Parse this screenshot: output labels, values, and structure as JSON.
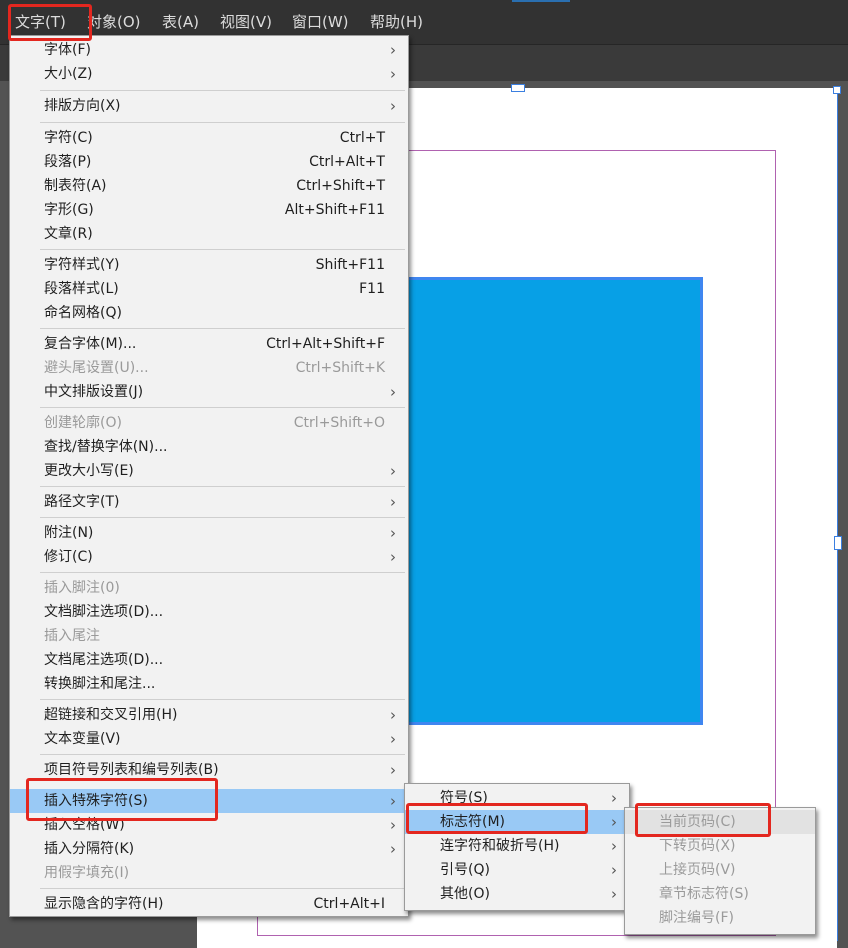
{
  "menubar": {
    "items": [
      {
        "label": "文字(T)"
      },
      {
        "label": "对象(O)"
      },
      {
        "label": "表(A)"
      },
      {
        "label": "视图(V)"
      },
      {
        "label": "窗口(W)"
      },
      {
        "label": "帮助(H)"
      }
    ]
  },
  "type_menu": {
    "items": [
      {
        "label": "字体(F)",
        "shortcut": "",
        "submenu": true
      },
      {
        "label": "大小(Z)",
        "shortcut": "",
        "submenu": true
      },
      {
        "label": "排版方向(X)",
        "shortcut": "",
        "submenu": true
      },
      {
        "label": "字符(C)",
        "shortcut": "Ctrl+T"
      },
      {
        "label": "段落(P)",
        "shortcut": "Ctrl+Alt+T"
      },
      {
        "label": "制表符(A)",
        "shortcut": "Ctrl+Shift+T"
      },
      {
        "label": "字形(G)",
        "shortcut": "Alt+Shift+F11"
      },
      {
        "label": "文章(R)",
        "shortcut": ""
      },
      {
        "label": "字符样式(Y)",
        "shortcut": "Shift+F11"
      },
      {
        "label": "段落样式(L)",
        "shortcut": "F11"
      },
      {
        "label": "命名网格(Q)",
        "shortcut": ""
      },
      {
        "label": "复合字体(M)...",
        "shortcut": "Ctrl+Alt+Shift+F"
      },
      {
        "label": "避头尾设置(U)...",
        "shortcut": "Ctrl+Shift+K",
        "disabled": true
      },
      {
        "label": "中文排版设置(J)",
        "shortcut": "",
        "submenu": true
      },
      {
        "label": "创建轮廓(O)",
        "shortcut": "Ctrl+Shift+O",
        "disabled": true
      },
      {
        "label": "查找/替换字体(N)...",
        "shortcut": ""
      },
      {
        "label": "更改大小写(E)",
        "shortcut": "",
        "submenu": true
      },
      {
        "label": "路径文字(T)",
        "shortcut": "",
        "submenu": true
      },
      {
        "label": "附注(N)",
        "shortcut": "",
        "submenu": true
      },
      {
        "label": "修订(C)",
        "shortcut": "",
        "submenu": true
      },
      {
        "label": "插入脚注(0)",
        "shortcut": "",
        "disabled": true
      },
      {
        "label": "文档脚注选项(D)...",
        "shortcut": ""
      },
      {
        "label": "插入尾注",
        "shortcut": "",
        "disabled": true
      },
      {
        "label": "文档尾注选项(D)...",
        "shortcut": ""
      },
      {
        "label": "转换脚注和尾注...",
        "shortcut": ""
      },
      {
        "label": "超链接和交叉引用(H)",
        "shortcut": "",
        "submenu": true
      },
      {
        "label": "文本变量(V)",
        "shortcut": "",
        "submenu": true
      },
      {
        "label": "项目符号列表和编号列表(B)",
        "shortcut": "",
        "submenu": true
      },
      {
        "label": "插入特殊字符(S)",
        "shortcut": "",
        "submenu": true,
        "highlighted": true
      },
      {
        "label": "插入空格(W)",
        "shortcut": "",
        "submenu": true
      },
      {
        "label": "插入分隔符(K)",
        "shortcut": "",
        "submenu": true
      },
      {
        "label": "用假字填充(I)",
        "shortcut": "",
        "disabled": true
      },
      {
        "label": "显示隐含的字符(H)",
        "shortcut": "Ctrl+Alt+I"
      }
    ]
  },
  "special_chars_menu": {
    "items": [
      {
        "label": "符号(S)",
        "submenu": true
      },
      {
        "label": "标志符(M)",
        "submenu": true,
        "highlighted": true
      },
      {
        "label": "连字符和破折号(H)",
        "submenu": true
      },
      {
        "label": "引号(Q)",
        "submenu": true
      },
      {
        "label": "其他(O)",
        "submenu": true
      }
    ]
  },
  "markers_menu": {
    "items": [
      {
        "label": "当前页码(C)",
        "disabled": true
      },
      {
        "label": "下转页码(X)",
        "disabled": true
      },
      {
        "label": "上接页码(V)",
        "disabled": true
      },
      {
        "label": "章节标志符(S)",
        "disabled": true
      },
      {
        "label": "脚注编号(F)",
        "disabled": true
      }
    ]
  },
  "icons": {
    "submenu_arrow": "chevron-right-icon",
    "arrow_glyph": "›"
  },
  "colors": {
    "highlight": "#99c9f5",
    "annotation_box": "#e3271f",
    "shape_fill": "#07a0e6",
    "menubar_bg": "#323232",
    "menu_bg": "#f2f2f2"
  }
}
